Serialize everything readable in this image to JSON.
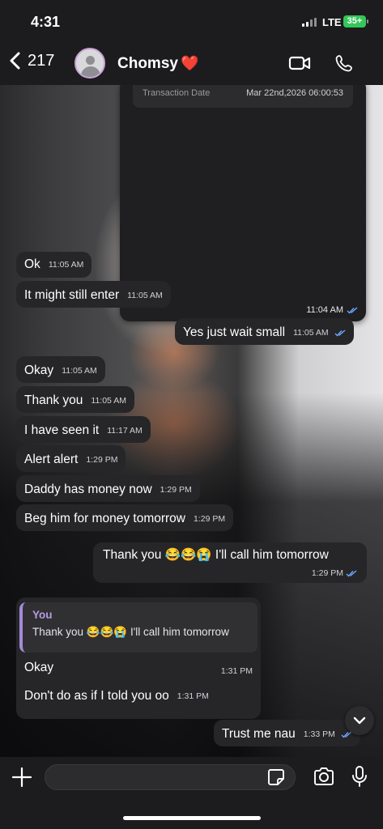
{
  "status_bar": {
    "time": "4:31",
    "network": "LTE",
    "battery": "35+"
  },
  "header": {
    "back_count": "217",
    "contact_name": "Chomsy",
    "contact_emoji": "❤️"
  },
  "media_card": {
    "transaction_label": "Transaction Date",
    "transaction_value": "Mar 22nd,2026 06:00:53",
    "time": "11:04 AM"
  },
  "messages": [
    {
      "dir": "in",
      "text": "Ok",
      "time": "11:05 AM"
    },
    {
      "dir": "in",
      "text": "It might still enter",
      "time": "11:05 AM"
    },
    {
      "dir": "out",
      "text": "Yes just wait small",
      "time": "11:05 AM"
    },
    {
      "dir": "in",
      "text": "Okay",
      "time": "11:05 AM"
    },
    {
      "dir": "in",
      "text": "Thank you",
      "time": "11:05 AM"
    },
    {
      "dir": "in",
      "text": "I have seen it",
      "time": "11:17 AM"
    },
    {
      "dir": "in",
      "text": "Alert alert",
      "time": "1:29 PM"
    },
    {
      "dir": "in",
      "text": "Daddy has money now",
      "time": "1:29 PM"
    },
    {
      "dir": "in",
      "text": "Beg him for money tomorrow",
      "time": "1:29 PM"
    },
    {
      "dir": "out",
      "text": "Thank you 😂😂😭 I'll call him tomorrow",
      "time": "1:29 PM"
    },
    {
      "dir": "out",
      "text": "Trust me nau",
      "time": "1:33 PM"
    }
  ],
  "reply": {
    "quoted_author": "You",
    "quoted_text": "Thank you 😂😂😭 I'll call him tomorrow",
    "text": "Okay",
    "time": "1:31 PM"
  },
  "message_after_reply": {
    "text": "Don't do as if I told you oo",
    "time": "1:31 PM"
  },
  "input": {
    "placeholder": ""
  },
  "colors": {
    "bubble": "#262628",
    "accent": "#a38bd8",
    "read_ticks": "#6ea8ff",
    "battery": "#34c759"
  }
}
